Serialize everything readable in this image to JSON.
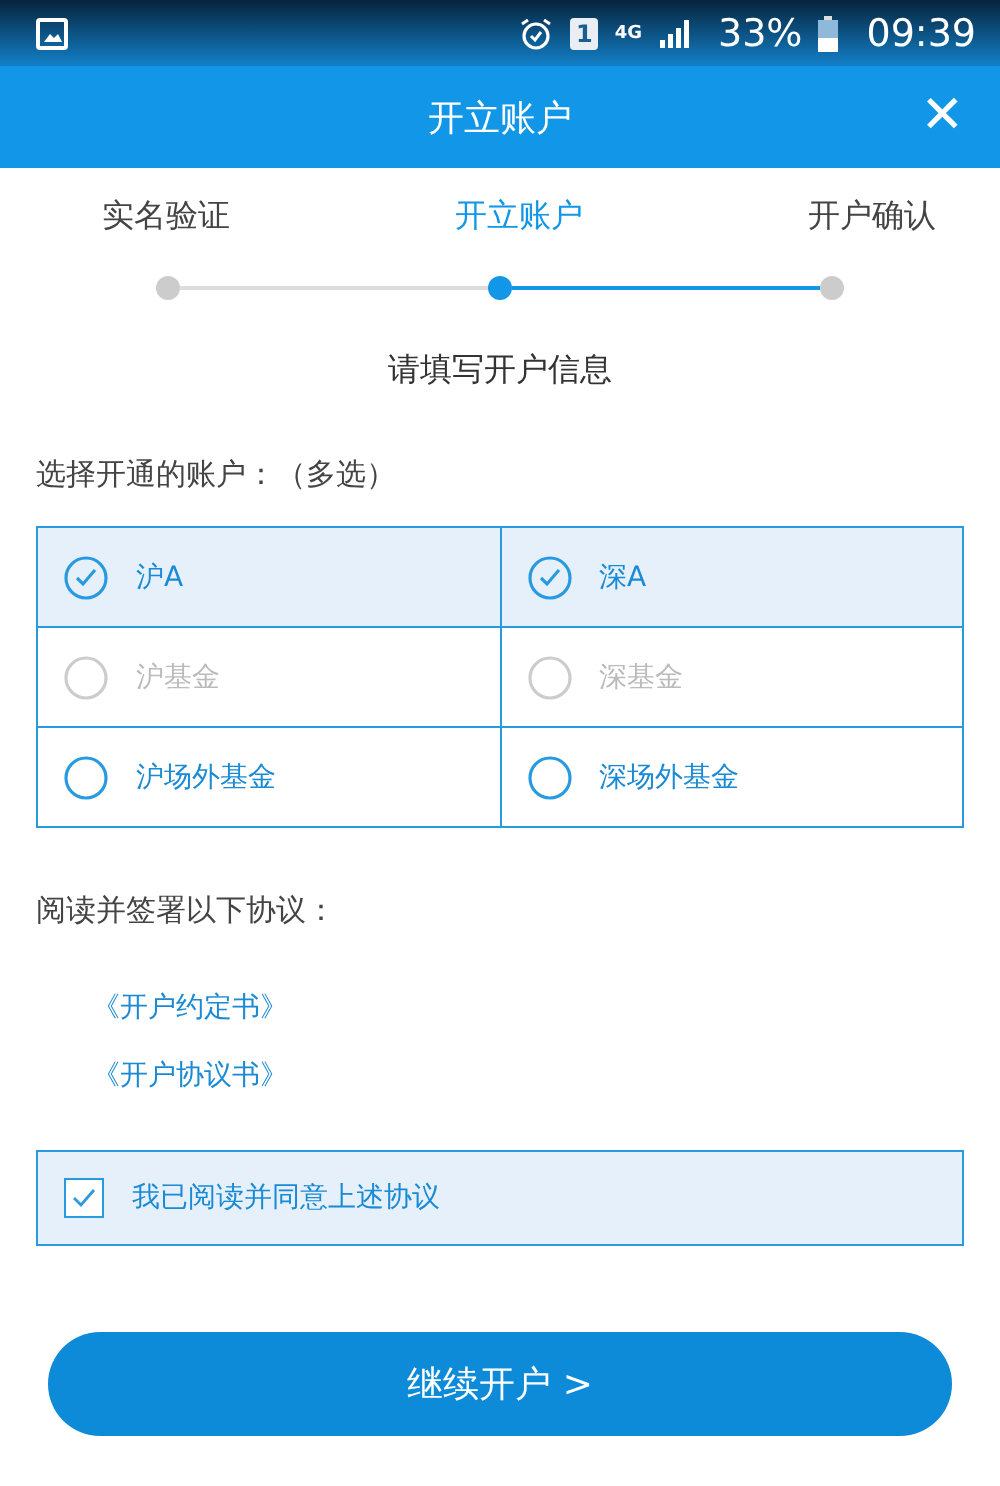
{
  "status_bar": {
    "sim_label": "1",
    "network_label": "4G",
    "battery": "33%",
    "time": "09:39"
  },
  "header": {
    "title": "开立账户",
    "close": "✕"
  },
  "steps": [
    {
      "label": "实名验证",
      "selected": false
    },
    {
      "label": "开立账户",
      "selected": true
    },
    {
      "label": "开户确认",
      "selected": false
    }
  ],
  "subtitle": "请填写开户信息",
  "account_section": {
    "label": "选择开通的账户：（多选）",
    "options": [
      {
        "label": "沪A",
        "checked": true,
        "disabled": false
      },
      {
        "label": "深A",
        "checked": true,
        "disabled": false
      },
      {
        "label": "沪基金",
        "checked": false,
        "disabled": true
      },
      {
        "label": "深基金",
        "checked": false,
        "disabled": true
      },
      {
        "label": "沪场外基金",
        "checked": false,
        "disabled": false
      },
      {
        "label": "深场外基金",
        "checked": false,
        "disabled": false
      }
    ]
  },
  "agreement_section": {
    "label": "阅读并签署以下协议：",
    "links": [
      "《开户约定书》",
      "《开户协议书》"
    ],
    "consent": {
      "label": "我已阅读并同意上述协议",
      "checked": true
    }
  },
  "continue_button": "继续开户 >"
}
